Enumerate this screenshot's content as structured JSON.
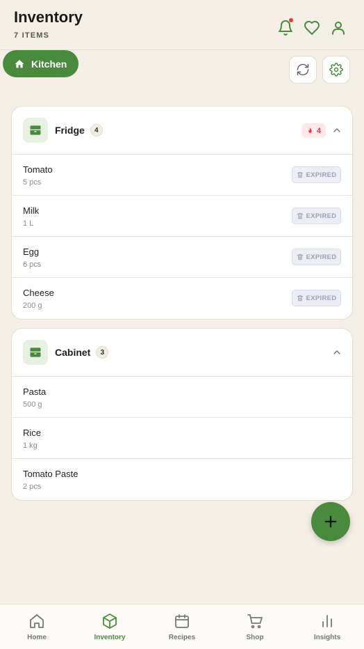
{
  "header": {
    "title": "Inventory",
    "subtitle": "7 ITEMS"
  },
  "location": {
    "label": "Kitchen"
  },
  "colors": {
    "accent": "#4a8a3f",
    "danger": "#e53950",
    "background": "#f3efe6"
  },
  "sections": [
    {
      "name": "Fridge",
      "count": "4",
      "alert_count": "4",
      "items": [
        {
          "name": "Tomato",
          "qty": "5 pcs",
          "status": "EXPIRED"
        },
        {
          "name": "Milk",
          "qty": "1 L",
          "status": "EXPIRED"
        },
        {
          "name": "Egg",
          "qty": "6 pcs",
          "status": "EXPIRED"
        },
        {
          "name": "Cheese",
          "qty": "200 g",
          "status": "EXPIRED"
        }
      ]
    },
    {
      "name": "Cabinet",
      "count": "3",
      "items": [
        {
          "name": "Pasta",
          "qty": "500 g"
        },
        {
          "name": "Rice",
          "qty": "1 kg"
        },
        {
          "name": "Tomato Paste",
          "qty": "2 pcs"
        }
      ]
    }
  ],
  "nav": [
    {
      "label": "Home",
      "icon": "home-icon"
    },
    {
      "label": "Inventory",
      "icon": "cube-icon",
      "active": true
    },
    {
      "label": "Recipes",
      "icon": "calendar-icon"
    },
    {
      "label": "Shop",
      "icon": "cart-icon"
    },
    {
      "label": "Insights",
      "icon": "bar-chart-icon"
    }
  ]
}
